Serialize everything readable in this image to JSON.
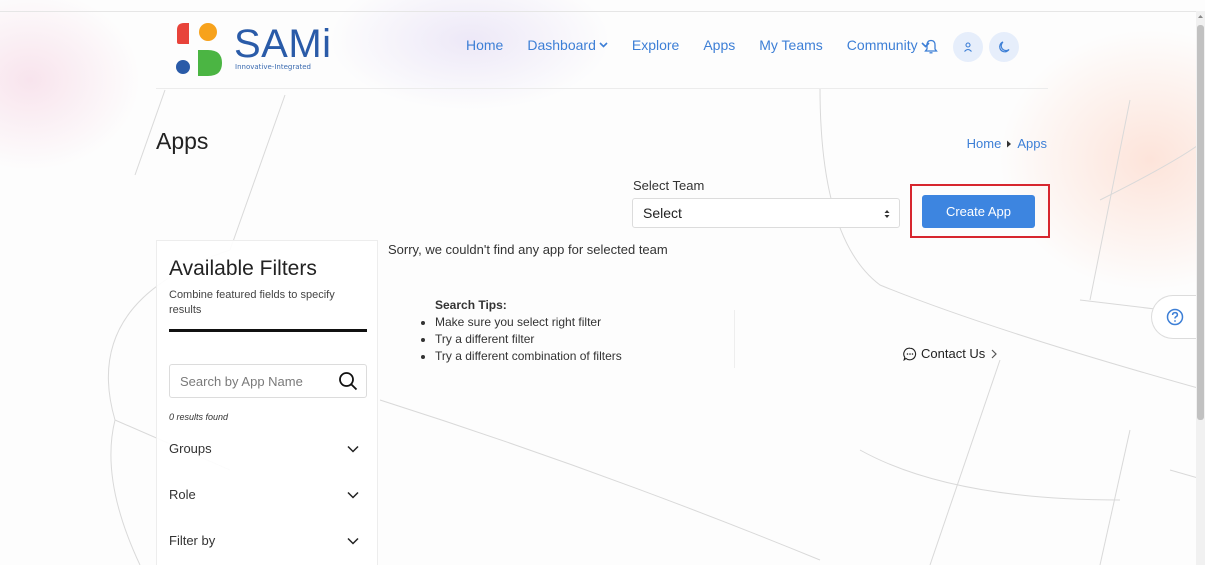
{
  "brand": {
    "name": "SAMi",
    "tagline": "Innovative-Integrated",
    "colors": {
      "red": "#e8433a",
      "orange": "#f7a21c",
      "blue": "#2a5ba8",
      "green": "#4bb543"
    }
  },
  "nav": {
    "items": [
      {
        "label": "Home"
      },
      {
        "label": "Dashboard",
        "has_dropdown": true
      },
      {
        "label": "Explore"
      },
      {
        "label": "Apps"
      },
      {
        "label": "My Teams"
      },
      {
        "label": "Community",
        "has_dropdown": true
      }
    ],
    "icons": [
      "bell-icon",
      "user-icon",
      "moon-icon"
    ],
    "accent": "#3d7fd6"
  },
  "page": {
    "title": "Apps",
    "breadcrumb": [
      "Home",
      "Apps"
    ]
  },
  "team": {
    "label": "Select Team",
    "selected": "Select"
  },
  "actions": {
    "create_app": "Create App",
    "create_color": "#3d85e0",
    "highlight_color": "#d7262e"
  },
  "filters": {
    "title": "Available Filters",
    "subtitle": "Combine featured fields to specify results",
    "search_placeholder": "Search by App Name",
    "results": "0 results found",
    "groups": [
      {
        "label": "Groups"
      },
      {
        "label": "Role"
      },
      {
        "label": "Filter by"
      }
    ]
  },
  "empty": {
    "message": "Sorry, we couldn't find any app for selected team",
    "tips_title": "Search Tips:",
    "tips": [
      "Make sure you select right filter",
      "Try a different filter",
      "Try a different combination of filters"
    ],
    "contact": "Contact Us"
  }
}
